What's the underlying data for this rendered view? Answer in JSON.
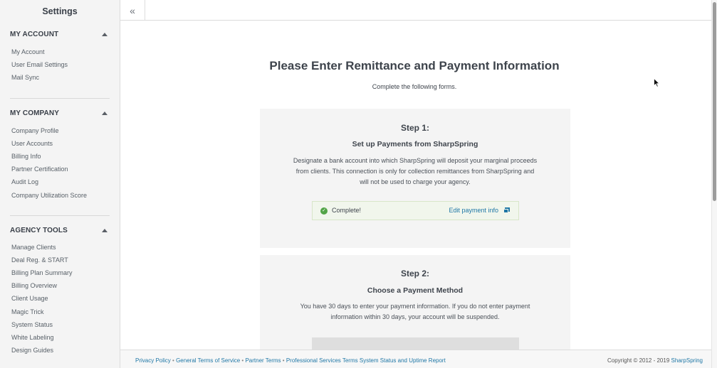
{
  "sidebar": {
    "title": "Settings",
    "sections": [
      {
        "heading": "MY ACCOUNT",
        "items": [
          "My Account",
          "User Email Settings",
          "Mail Sync"
        ]
      },
      {
        "heading": "MY COMPANY",
        "items": [
          "Company Profile",
          "User Accounts",
          "Billing Info",
          "Partner Certification",
          "Audit Log",
          "Company Utilization Score"
        ]
      },
      {
        "heading": "AGENCY TOOLS",
        "items": [
          "Manage Clients",
          "Deal Reg. & START",
          "Billing Plan Summary",
          "Billing Overview",
          "Client Usage",
          "Magic Trick",
          "System Status",
          "White Labeling",
          "Design Guides"
        ]
      }
    ]
  },
  "topbar": {
    "collapse_glyph": "«"
  },
  "main": {
    "title": "Please Enter Remittance and Payment Information",
    "subtitle": "Complete the following forms.",
    "step1": {
      "number": "Step 1:",
      "title": "Set up Payments from SharpSpring",
      "desc_line1": "Designate a bank account into which SharpSpring will deposit your marginal proceeds",
      "desc_line2": "from clients. This connection is only for collection remittances from SharpSpring and",
      "desc_line3": "will not be used to charge your agency.",
      "status": "Complete!",
      "edit_link": "Edit payment info"
    },
    "step2": {
      "number": "Step 2:",
      "title": "Choose a Payment Method",
      "desc_line1": "You have 30 days to enter your payment information. If you do not enter payment",
      "desc_line2": "information within 30 days, your account will be suspended."
    }
  },
  "footer": {
    "links": [
      "Privacy Policy",
      "General Terms of Service",
      "Partner Terms",
      "Professional Services Terms",
      "System Status and Uptime Report"
    ],
    "separator": "•",
    "copyright": "Copyright © 2012 - 2019",
    "brand": "SharpSpring"
  },
  "colors": {
    "link": "#1f77a6",
    "success": "#52a447",
    "sidebar_bg": "#f4f4f4",
    "card_bg": "#f4f4f4"
  }
}
